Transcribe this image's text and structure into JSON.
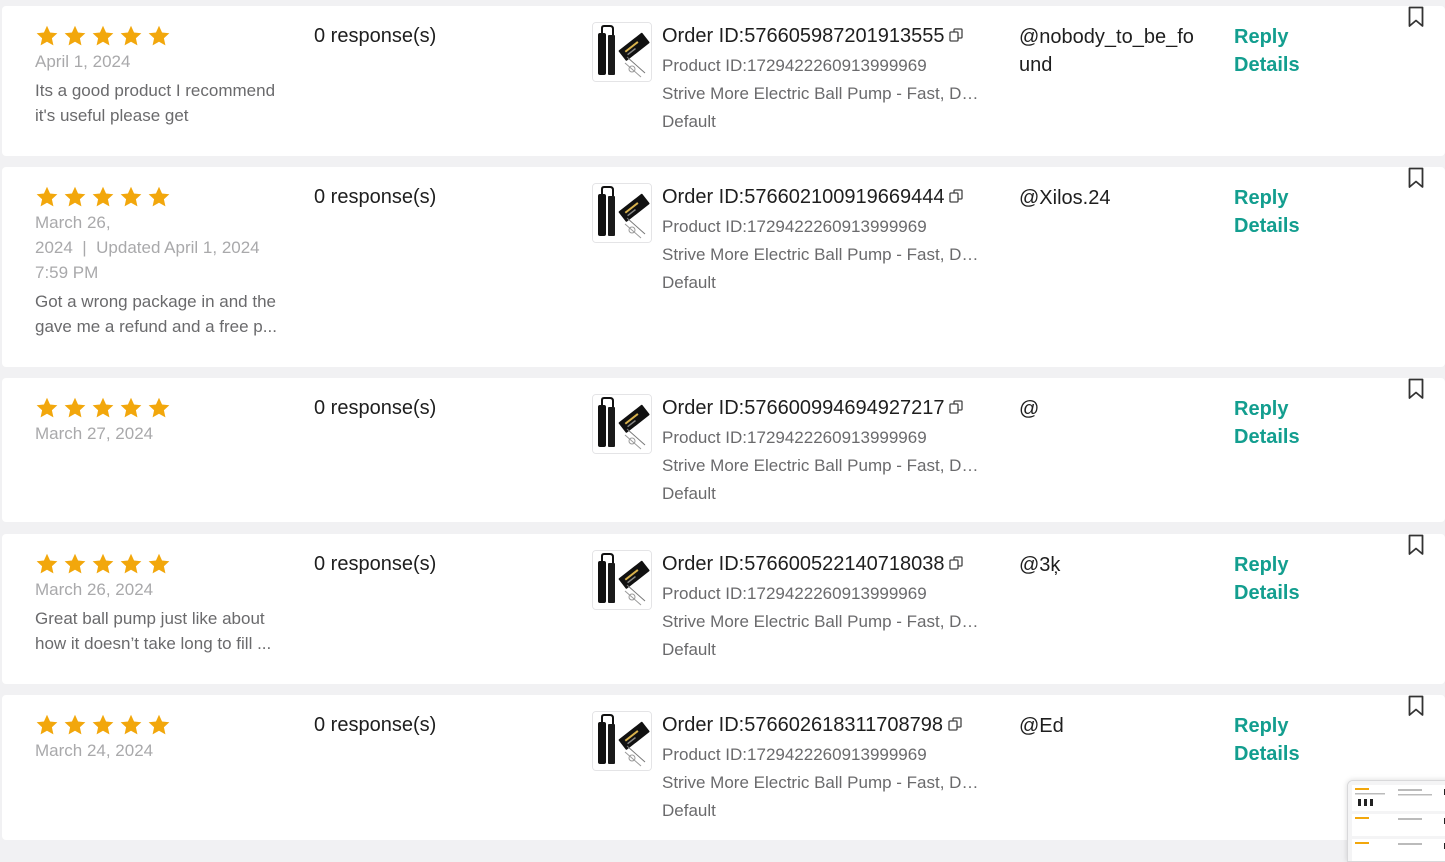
{
  "colors": {
    "star": "#f2a70c",
    "action": "#139e8f",
    "muted": "#a9a9ab",
    "body_text": "#6a6a6c",
    "primary_text": "#1e1e1e"
  },
  "reviews": [
    {
      "rating": 5,
      "date_lines": [
        "April 1, 2024"
      ],
      "review_lines": [
        "Its a good product I recommend",
        "it's useful please get"
      ],
      "responses": "0 response(s)",
      "order_id": "Order ID:576605987201913555",
      "product_id": "Product ID:1729422260913999969",
      "product_name": "Strive More Electric Ball Pump - Fast, Durable, Portable",
      "variant": "Default",
      "username": "@nobody_to_be_found",
      "reply_label": "Reply",
      "details_label": "Details"
    },
    {
      "rating": 5,
      "date_lines": [
        "March 26,",
        "2024  |  Updated April 1, 2024",
        "7:59 PM"
      ],
      "review_lines": [
        "Got a wrong package in and the",
        "gave me a refund and a free p..."
      ],
      "responses": "0 response(s)",
      "order_id": "Order ID:576602100919669444",
      "product_id": "Product ID:1729422260913999969",
      "product_name": "Strive More Electric Ball Pump - Fast, Durable, Portable",
      "variant": "Default",
      "username": "@Xilos.24",
      "reply_label": "Reply",
      "details_label": "Details"
    },
    {
      "rating": 5,
      "date_lines": [
        "March 27, 2024"
      ],
      "review_lines": [],
      "responses": "0 response(s)",
      "order_id": "Order ID:576600994694927217",
      "product_id": "Product ID:1729422260913999969",
      "product_name": "Strive More Electric Ball Pump - Fast, Durable, Portable",
      "variant": "Default",
      "username": "@",
      "reply_label": "Reply",
      "details_label": "Details"
    },
    {
      "rating": 5,
      "date_lines": [
        "March 26, 2024"
      ],
      "review_lines": [
        "Great ball pump just like about",
        "how it doesn’t take long to fill ..."
      ],
      "responses": "0 response(s)",
      "order_id": "Order ID:576600522140718038",
      "product_id": "Product ID:1729422260913999969",
      "product_name": "Strive More Electric Ball Pump - Fast, Durable, Portable",
      "variant": "Default",
      "username": "@3ķ",
      "reply_label": "Reply",
      "details_label": "Details"
    },
    {
      "rating": 5,
      "date_lines": [
        "March 24, 2024"
      ],
      "review_lines": [],
      "responses": "0 response(s)",
      "order_id": "Order ID:576602618311708798",
      "product_id": "Product ID:1729422260913999969",
      "product_name": "Strive More Electric Ball Pump - Fast, Durable, Portable",
      "variant": "Default",
      "username": "@Ed",
      "reply_label": "Reply",
      "details_label": "Details"
    }
  ]
}
